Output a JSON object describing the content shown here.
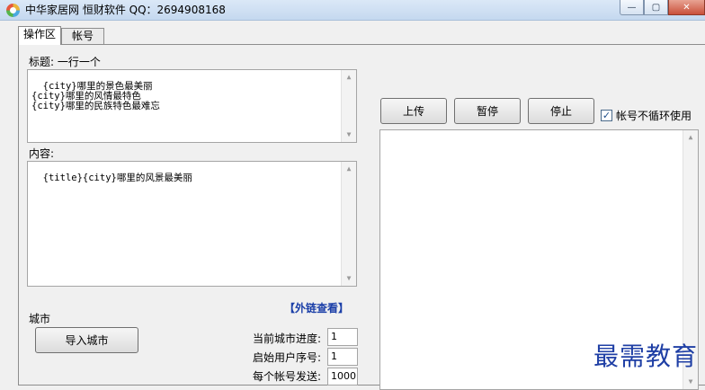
{
  "window": {
    "title": "中华家居网  恒财软件 QQ：2694908168",
    "minimize_glyph": "—",
    "maximize_glyph": "▢",
    "close_glyph": "✕"
  },
  "tabs": [
    {
      "label": "操作区",
      "active": true
    },
    {
      "label": "帐号",
      "active": false
    }
  ],
  "title_section": {
    "label": "标题: 一行一个",
    "content": "{city}哪里的景色最美丽\n{city}哪里的风情最特色\n{city}哪里的民族特色最难忘"
  },
  "content_section": {
    "label": "内容:",
    "content": "{title}{city}哪里的风景最美丽"
  },
  "external_link": "【外链查看】",
  "city_section": {
    "label": "城市",
    "import_button": "导入城市"
  },
  "fields": [
    {
      "label": "当前城市进度:",
      "value": "1"
    },
    {
      "label": "启始用户序号:",
      "value": "1"
    },
    {
      "label": "每个帐号发送:",
      "value": "1000"
    }
  ],
  "controls": {
    "upload": "上传",
    "pause": "暂停",
    "stop": "停止",
    "no_loop_label": "帐号不循环使用",
    "no_loop_checked": true,
    "check_glyph": "✓"
  },
  "scroll_glyphs": {
    "up": "▲",
    "down": "▼"
  },
  "watermark": "最需教育",
  "colors": {
    "link": "#1b3fa8",
    "watermark": "#1f3fa5",
    "titlebar": "#c4d8ef"
  }
}
